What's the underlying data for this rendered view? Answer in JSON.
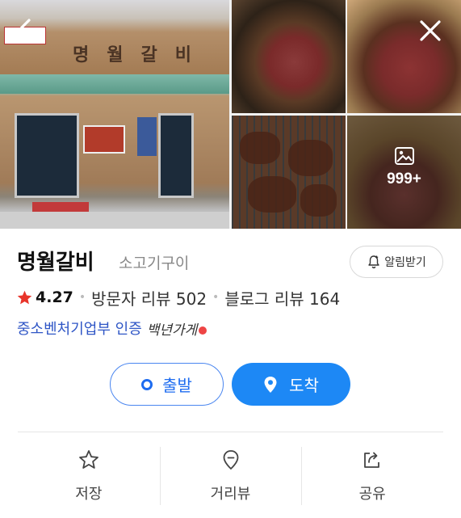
{
  "gallery": {
    "storefront_sign": "명월갈비",
    "more_count": "999+"
  },
  "place": {
    "name": "명월갈비",
    "category": "소고기구이",
    "alarm_label": "알림받기",
    "rating": "4.27",
    "visitor_reviews": "방문자 리뷰 502",
    "blog_reviews": "블로그 리뷰 164",
    "certification": "중소벤처기업부 인증",
    "cert_badge": "백년가게"
  },
  "cta": {
    "depart_label": "출발",
    "arrive_label": "도착"
  },
  "actions": {
    "save_label": "저장",
    "distance_view_label": "거리뷰",
    "share_label": "공유"
  },
  "colors": {
    "accent_blue": "#1d88f5",
    "link_blue": "#2f56c6",
    "star_red": "#e8352b"
  }
}
